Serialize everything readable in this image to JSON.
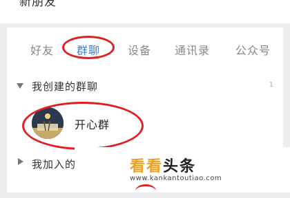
{
  "top": {
    "partial_text": "新朋友"
  },
  "tabs": [
    {
      "label": "好友",
      "active": false
    },
    {
      "label": "群聊",
      "active": true
    },
    {
      "label": "设备",
      "active": false
    },
    {
      "label": "通讯录",
      "active": false
    },
    {
      "label": "公众号",
      "active": false
    }
  ],
  "created_group": {
    "title": "我创建的群聊",
    "count": "1",
    "items": [
      {
        "name": "开心群",
        "avatar_icon": "moon-night-avatar-icon"
      }
    ]
  },
  "joined_group": {
    "title": "我加入的群聊"
  },
  "watermark": {
    "title_part1": "看看",
    "title_part2": "头条",
    "url": "www.kankantoutiao.com"
  },
  "colors": {
    "accent_blue": "#3a7fd5",
    "annotation_red": "#e02020",
    "watermark_orange": "#f0a020"
  }
}
